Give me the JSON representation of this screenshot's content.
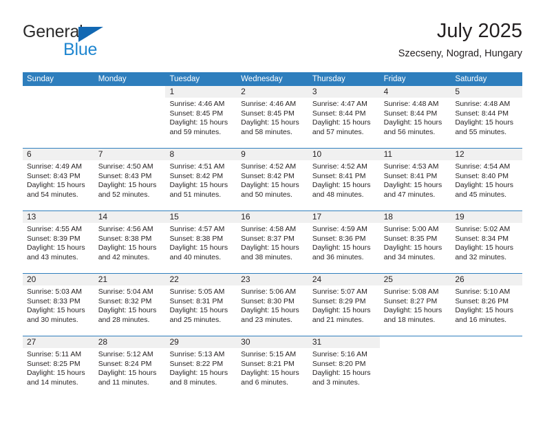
{
  "brand": {
    "name_top": "General",
    "name_bottom": "Blue",
    "accent_color": "#1268b3",
    "text_color": "#1f86d0"
  },
  "header": {
    "title": "July 2025",
    "subtitle": "Szecseny, Nograd, Hungary"
  },
  "theme": {
    "header_bg": "#2e7ebd",
    "header_text": "#ffffff",
    "daynum_bg": "#f0f0f0",
    "body_text": "#231f20"
  },
  "calendar": {
    "weekdays": [
      "Sunday",
      "Monday",
      "Tuesday",
      "Wednesday",
      "Thursday",
      "Friday",
      "Saturday"
    ],
    "weeks": [
      [
        {
          "day": "",
          "sunrise": "",
          "sunset": "",
          "daylight": "",
          "daylight2": ""
        },
        {
          "day": "",
          "sunrise": "",
          "sunset": "",
          "daylight": "",
          "daylight2": ""
        },
        {
          "day": "1",
          "sunrise": "Sunrise: 4:46 AM",
          "sunset": "Sunset: 8:45 PM",
          "daylight": "Daylight: 15 hours",
          "daylight2": "and 59 minutes."
        },
        {
          "day": "2",
          "sunrise": "Sunrise: 4:46 AM",
          "sunset": "Sunset: 8:45 PM",
          "daylight": "Daylight: 15 hours",
          "daylight2": "and 58 minutes."
        },
        {
          "day": "3",
          "sunrise": "Sunrise: 4:47 AM",
          "sunset": "Sunset: 8:44 PM",
          "daylight": "Daylight: 15 hours",
          "daylight2": "and 57 minutes."
        },
        {
          "day": "4",
          "sunrise": "Sunrise: 4:48 AM",
          "sunset": "Sunset: 8:44 PM",
          "daylight": "Daylight: 15 hours",
          "daylight2": "and 56 minutes."
        },
        {
          "day": "5",
          "sunrise": "Sunrise: 4:48 AM",
          "sunset": "Sunset: 8:44 PM",
          "daylight": "Daylight: 15 hours",
          "daylight2": "and 55 minutes."
        }
      ],
      [
        {
          "day": "6",
          "sunrise": "Sunrise: 4:49 AM",
          "sunset": "Sunset: 8:43 PM",
          "daylight": "Daylight: 15 hours",
          "daylight2": "and 54 minutes."
        },
        {
          "day": "7",
          "sunrise": "Sunrise: 4:50 AM",
          "sunset": "Sunset: 8:43 PM",
          "daylight": "Daylight: 15 hours",
          "daylight2": "and 52 minutes."
        },
        {
          "day": "8",
          "sunrise": "Sunrise: 4:51 AM",
          "sunset": "Sunset: 8:42 PM",
          "daylight": "Daylight: 15 hours",
          "daylight2": "and 51 minutes."
        },
        {
          "day": "9",
          "sunrise": "Sunrise: 4:52 AM",
          "sunset": "Sunset: 8:42 PM",
          "daylight": "Daylight: 15 hours",
          "daylight2": "and 50 minutes."
        },
        {
          "day": "10",
          "sunrise": "Sunrise: 4:52 AM",
          "sunset": "Sunset: 8:41 PM",
          "daylight": "Daylight: 15 hours",
          "daylight2": "and 48 minutes."
        },
        {
          "day": "11",
          "sunrise": "Sunrise: 4:53 AM",
          "sunset": "Sunset: 8:41 PM",
          "daylight": "Daylight: 15 hours",
          "daylight2": "and 47 minutes."
        },
        {
          "day": "12",
          "sunrise": "Sunrise: 4:54 AM",
          "sunset": "Sunset: 8:40 PM",
          "daylight": "Daylight: 15 hours",
          "daylight2": "and 45 minutes."
        }
      ],
      [
        {
          "day": "13",
          "sunrise": "Sunrise: 4:55 AM",
          "sunset": "Sunset: 8:39 PM",
          "daylight": "Daylight: 15 hours",
          "daylight2": "and 43 minutes."
        },
        {
          "day": "14",
          "sunrise": "Sunrise: 4:56 AM",
          "sunset": "Sunset: 8:38 PM",
          "daylight": "Daylight: 15 hours",
          "daylight2": "and 42 minutes."
        },
        {
          "day": "15",
          "sunrise": "Sunrise: 4:57 AM",
          "sunset": "Sunset: 8:38 PM",
          "daylight": "Daylight: 15 hours",
          "daylight2": "and 40 minutes."
        },
        {
          "day": "16",
          "sunrise": "Sunrise: 4:58 AM",
          "sunset": "Sunset: 8:37 PM",
          "daylight": "Daylight: 15 hours",
          "daylight2": "and 38 minutes."
        },
        {
          "day": "17",
          "sunrise": "Sunrise: 4:59 AM",
          "sunset": "Sunset: 8:36 PM",
          "daylight": "Daylight: 15 hours",
          "daylight2": "and 36 minutes."
        },
        {
          "day": "18",
          "sunrise": "Sunrise: 5:00 AM",
          "sunset": "Sunset: 8:35 PM",
          "daylight": "Daylight: 15 hours",
          "daylight2": "and 34 minutes."
        },
        {
          "day": "19",
          "sunrise": "Sunrise: 5:02 AM",
          "sunset": "Sunset: 8:34 PM",
          "daylight": "Daylight: 15 hours",
          "daylight2": "and 32 minutes."
        }
      ],
      [
        {
          "day": "20",
          "sunrise": "Sunrise: 5:03 AM",
          "sunset": "Sunset: 8:33 PM",
          "daylight": "Daylight: 15 hours",
          "daylight2": "and 30 minutes."
        },
        {
          "day": "21",
          "sunrise": "Sunrise: 5:04 AM",
          "sunset": "Sunset: 8:32 PM",
          "daylight": "Daylight: 15 hours",
          "daylight2": "and 28 minutes."
        },
        {
          "day": "22",
          "sunrise": "Sunrise: 5:05 AM",
          "sunset": "Sunset: 8:31 PM",
          "daylight": "Daylight: 15 hours",
          "daylight2": "and 25 minutes."
        },
        {
          "day": "23",
          "sunrise": "Sunrise: 5:06 AM",
          "sunset": "Sunset: 8:30 PM",
          "daylight": "Daylight: 15 hours",
          "daylight2": "and 23 minutes."
        },
        {
          "day": "24",
          "sunrise": "Sunrise: 5:07 AM",
          "sunset": "Sunset: 8:29 PM",
          "daylight": "Daylight: 15 hours",
          "daylight2": "and 21 minutes."
        },
        {
          "day": "25",
          "sunrise": "Sunrise: 5:08 AM",
          "sunset": "Sunset: 8:27 PM",
          "daylight": "Daylight: 15 hours",
          "daylight2": "and 18 minutes."
        },
        {
          "day": "26",
          "sunrise": "Sunrise: 5:10 AM",
          "sunset": "Sunset: 8:26 PM",
          "daylight": "Daylight: 15 hours",
          "daylight2": "and 16 minutes."
        }
      ],
      [
        {
          "day": "27",
          "sunrise": "Sunrise: 5:11 AM",
          "sunset": "Sunset: 8:25 PM",
          "daylight": "Daylight: 15 hours",
          "daylight2": "and 14 minutes."
        },
        {
          "day": "28",
          "sunrise": "Sunrise: 5:12 AM",
          "sunset": "Sunset: 8:24 PM",
          "daylight": "Daylight: 15 hours",
          "daylight2": "and 11 minutes."
        },
        {
          "day": "29",
          "sunrise": "Sunrise: 5:13 AM",
          "sunset": "Sunset: 8:22 PM",
          "daylight": "Daylight: 15 hours",
          "daylight2": "and 8 minutes."
        },
        {
          "day": "30",
          "sunrise": "Sunrise: 5:15 AM",
          "sunset": "Sunset: 8:21 PM",
          "daylight": "Daylight: 15 hours",
          "daylight2": "and 6 minutes."
        },
        {
          "day": "31",
          "sunrise": "Sunrise: 5:16 AM",
          "sunset": "Sunset: 8:20 PM",
          "daylight": "Daylight: 15 hours",
          "daylight2": "and 3 minutes."
        },
        {
          "day": "",
          "sunrise": "",
          "sunset": "",
          "daylight": "",
          "daylight2": ""
        },
        {
          "day": "",
          "sunrise": "",
          "sunset": "",
          "daylight": "",
          "daylight2": ""
        }
      ]
    ]
  }
}
